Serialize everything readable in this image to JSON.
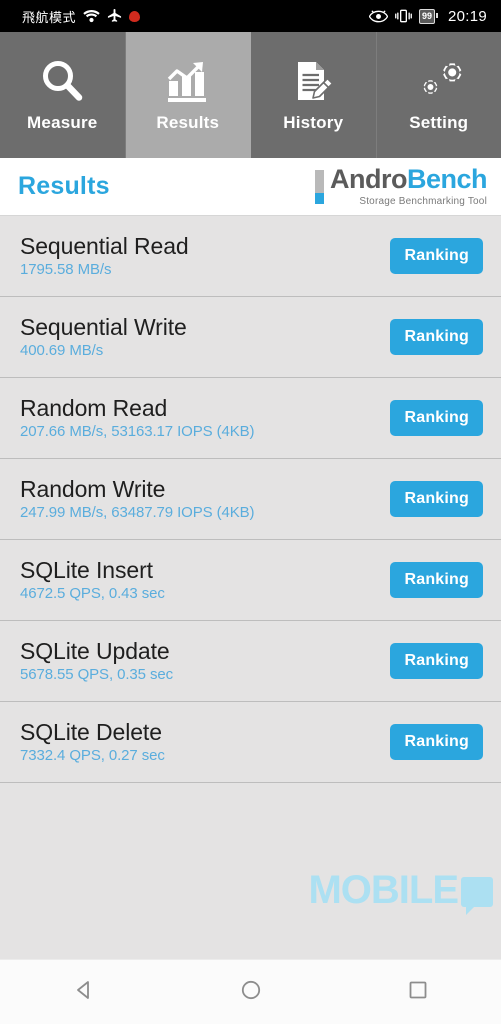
{
  "statusbar": {
    "airplane_text": "飛航模式",
    "wifi_icon": "wifi-icon",
    "airplane_icon": "airplane-icon",
    "alert_icon": "red-dot-icon",
    "eye_icon": "eye-comfort-icon",
    "vibrate_icon": "vibrate-icon",
    "battery_level": "99",
    "time": "20:19"
  },
  "tabs": [
    {
      "label": "Measure",
      "icon": "magnifier-icon",
      "selected": false
    },
    {
      "label": "Results",
      "icon": "bar-chart-icon",
      "selected": true
    },
    {
      "label": "History",
      "icon": "document-pencil-icon",
      "selected": false
    },
    {
      "label": "Setting",
      "icon": "gears-icon",
      "selected": false
    }
  ],
  "header": {
    "title": "Results",
    "brand_part1": "Andro",
    "brand_part2": "Bench",
    "brand_tagline": "Storage Benchmarking Tool"
  },
  "colors": {
    "accent_blue": "#2ba6de",
    "value_blue": "#5aaddd",
    "tab_inactive": "#6d6d6d",
    "tab_active": "#ababab",
    "list_background": "#e4e3e3",
    "watermark": "#ace0f2"
  },
  "results": {
    "button_label": "Ranking",
    "rows": [
      {
        "title": "Sequential Read",
        "value": "1795.58 MB/s"
      },
      {
        "title": "Sequential Write",
        "value": "400.69 MB/s"
      },
      {
        "title": "Random Read",
        "value": "207.66 MB/s, 53163.17 IOPS (4KB)"
      },
      {
        "title": "Random Write",
        "value": "247.99 MB/s, 63487.79 IOPS (4KB)"
      },
      {
        "title": "SQLite Insert",
        "value": "4672.5 QPS, 0.43 sec"
      },
      {
        "title": "SQLite Update",
        "value": "5678.55 QPS, 0.35 sec"
      },
      {
        "title": "SQLite Delete",
        "value": "7332.4 QPS, 0.27 sec"
      }
    ]
  },
  "watermark": {
    "text": "MOBILE",
    "bubble_icon": "speech-bubble-icon"
  },
  "navbar": {
    "back": "back-triangle-icon",
    "home": "home-circle-icon",
    "recents": "recents-square-icon"
  }
}
